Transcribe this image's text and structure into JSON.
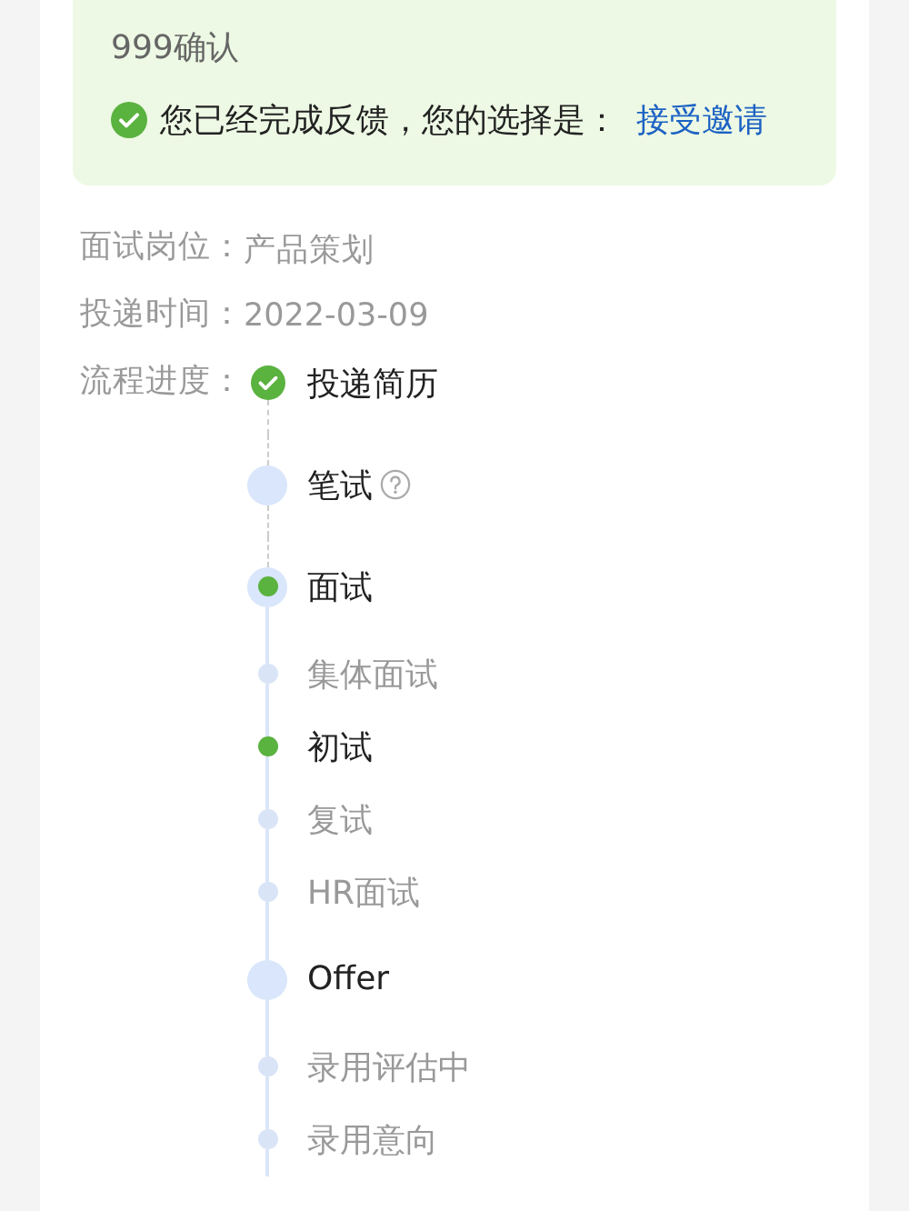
{
  "notice": {
    "text_tail": "999确认",
    "feedback": {
      "text": "您已经完成反馈，您的选择是：",
      "choice": "接受邀请"
    }
  },
  "info": [
    {
      "label": "面试岗位：",
      "value": "产品策划"
    },
    {
      "label": "投递时间：",
      "value": "2022-03-09"
    }
  ],
  "progress": {
    "label": "流程进度：",
    "steps": [
      {
        "kind": "stage",
        "name": "投递简历",
        "done": true,
        "current": false,
        "help": false
      },
      {
        "kind": "stage",
        "name": "笔试",
        "done": false,
        "current": false,
        "help": true
      },
      {
        "kind": "stage",
        "name": "面试",
        "done": false,
        "current": true,
        "help": false
      },
      {
        "kind": "substep",
        "name": "集体面试",
        "done": false
      },
      {
        "kind": "substep",
        "name": "初试",
        "done": true
      },
      {
        "kind": "substep",
        "name": "复试",
        "done": false
      },
      {
        "kind": "substep",
        "name": "HR面试",
        "done": false
      },
      {
        "kind": "stage",
        "name": "Offer",
        "done": false,
        "current": false,
        "help": false
      },
      {
        "kind": "substep",
        "name": "录用评估中",
        "done": false
      },
      {
        "kind": "substep",
        "name": "录用意向",
        "done": false
      }
    ]
  }
}
